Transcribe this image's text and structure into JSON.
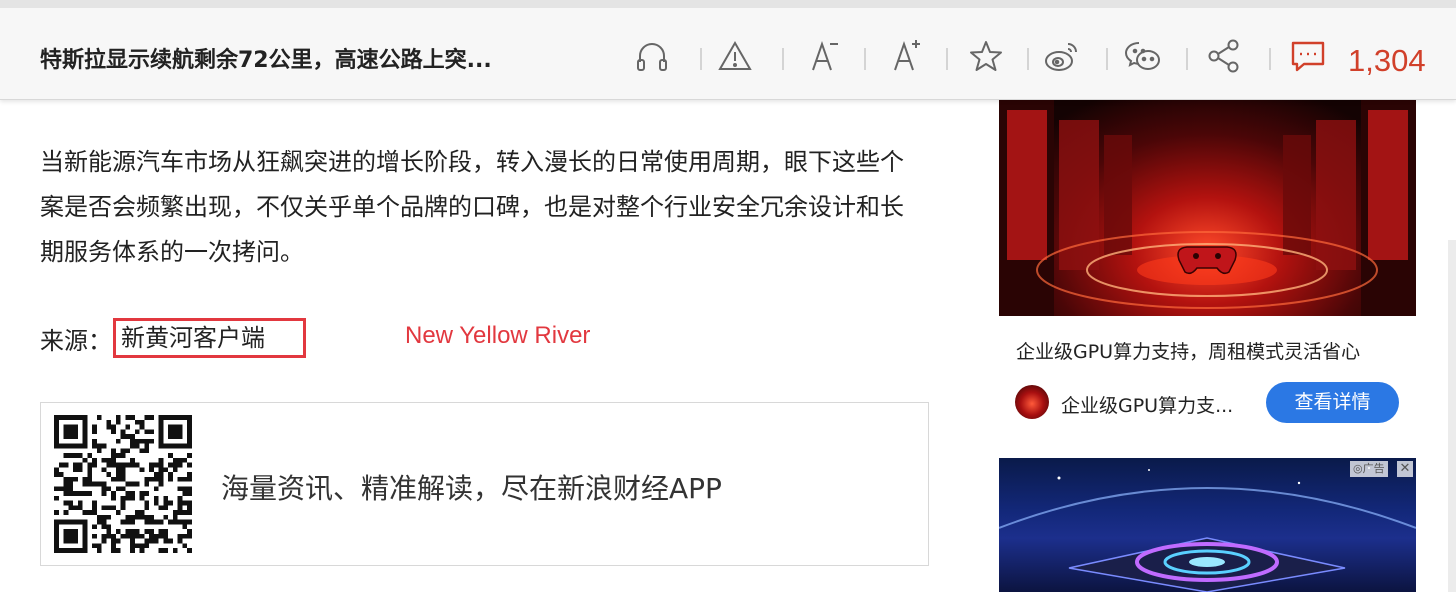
{
  "toolbar": {
    "title": "特斯拉显示续航剩余72公里，高速公路上突...",
    "icons": [
      "headphones-icon",
      "warning-icon",
      "font-decrease-icon",
      "font-increase-icon",
      "star-icon",
      "weibo-icon",
      "wechat-icon",
      "share-icon",
      "comment-icon"
    ],
    "comment_count": "1,304",
    "accent_color": "#d1402a"
  },
  "article": {
    "paragraph": "当新能源汽车市场从狂飙突进的增长阶段，转入漫长的日常使用周期，眼下这些个案是否会频繁出现，不仅关乎单个品牌的口碑，也是对整个行业安全冗余设计和长期服务体系的一次拷问。",
    "source_label": "来源：",
    "source_value": "新黄河客户端",
    "annotation": "New Yellow River"
  },
  "app_banner": {
    "text": "海量资讯、精准解读，尽在新浪财经APP"
  },
  "ads": {
    "ad1": {
      "caption": "企业级GPU算力支持，周租模式灵活省心",
      "brand": "企业级GPU算力支...",
      "button": "查看详情",
      "button_color": "#2b78e4"
    },
    "ad2": {
      "tag": "广告",
      "close": "✕"
    }
  }
}
